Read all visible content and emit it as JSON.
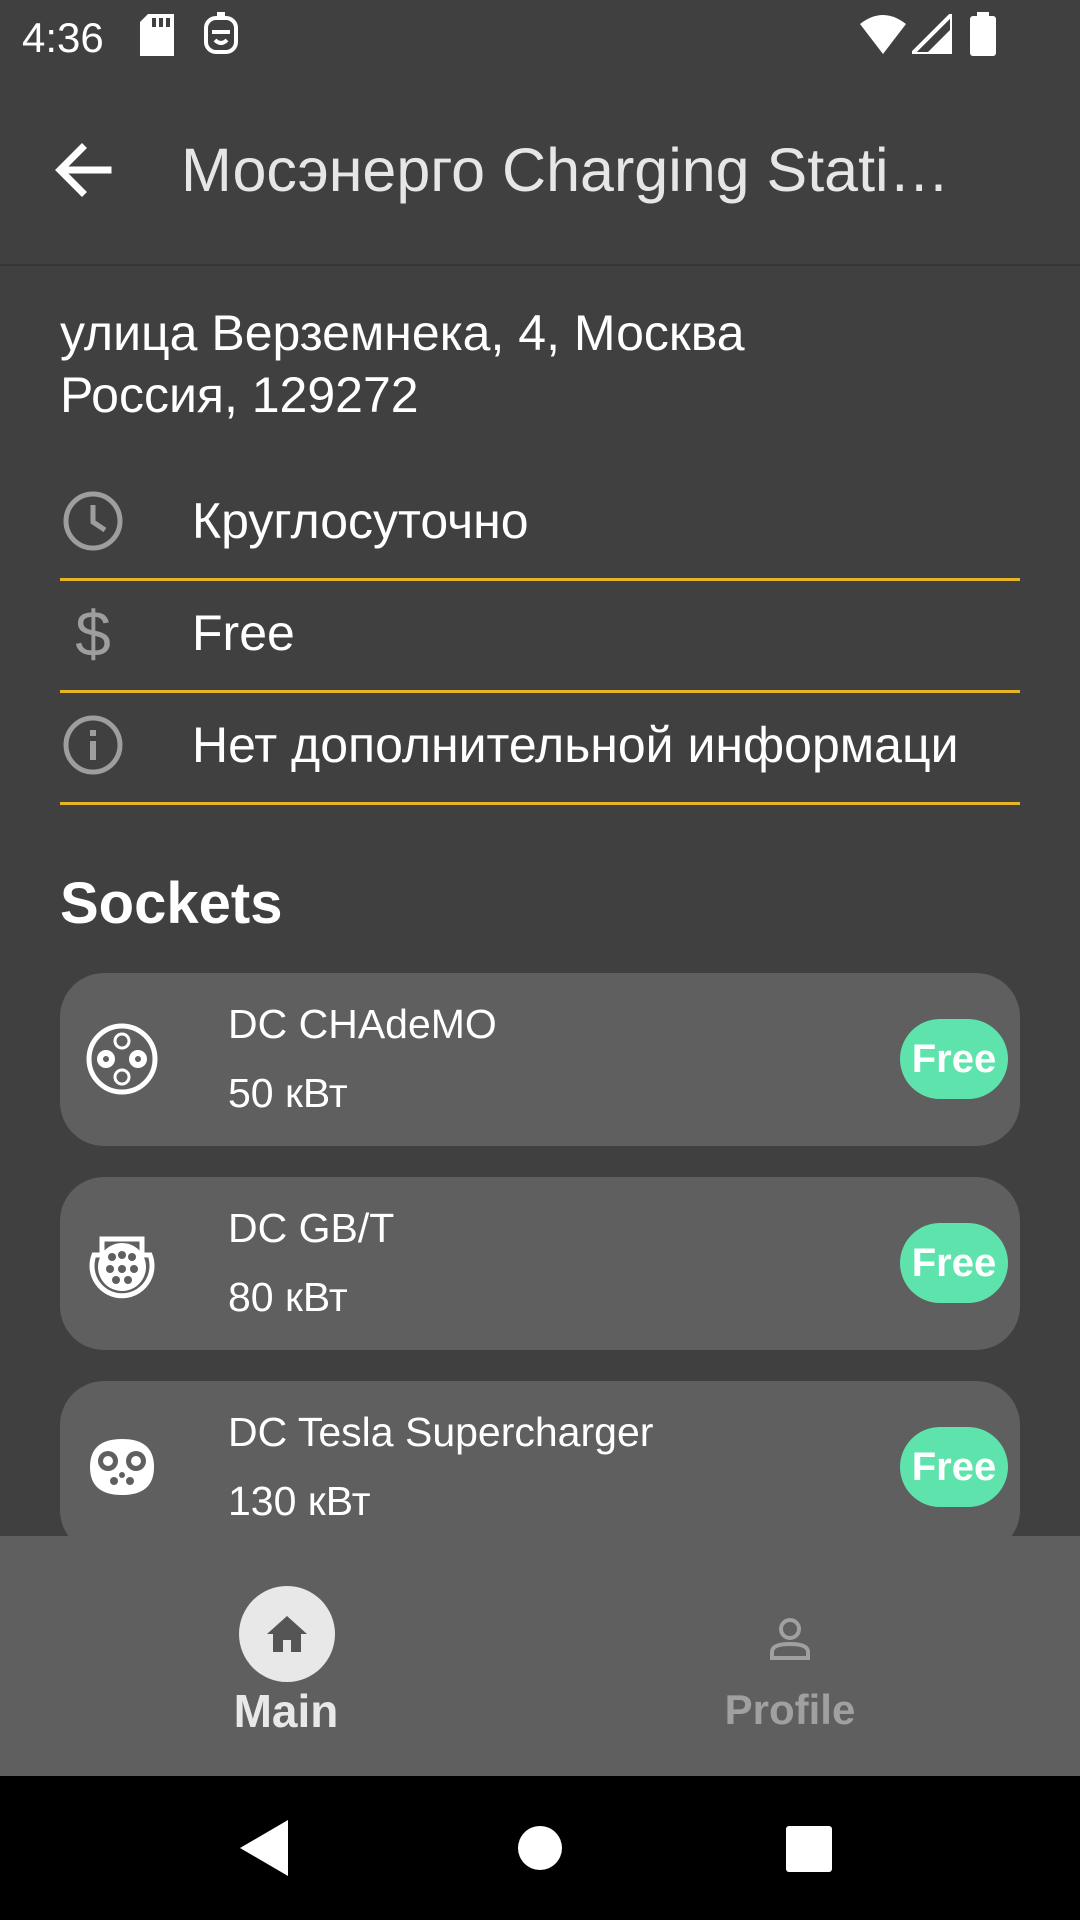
{
  "status_bar": {
    "time": "4:36"
  },
  "app_bar": {
    "title": "Мосэнерго Charging Stati…"
  },
  "address": {
    "line1": "улица Верземнека, 4, Москва",
    "line2": "Россия, 129272"
  },
  "info": [
    {
      "icon": "clock-icon",
      "text": "Круглосуточно"
    },
    {
      "icon": "dollar-icon",
      "text": "Free"
    },
    {
      "icon": "info-icon",
      "text": "Нет дополнительной информаци"
    }
  ],
  "sockets_heading": "Sockets",
  "sockets": [
    {
      "icon": "chademo-connector-icon",
      "name": "DC CHAdeMO",
      "power": "50 кВт",
      "status": "Free"
    },
    {
      "icon": "gbt-connector-icon",
      "name": "DC GB/T",
      "power": "80 кВт",
      "status": "Free"
    },
    {
      "icon": "tesla-connector-icon",
      "name": "DC Tesla Supercharger",
      "power": "130 кВт",
      "status": "Free"
    }
  ],
  "bottom_nav": {
    "main_label": "Main",
    "profile_label": "Profile",
    "selected": "Main"
  },
  "colors": {
    "background": "#404040",
    "card": "#5f5f5f",
    "accent_underline": "#e5b526",
    "status_free": "#5fe3ad"
  }
}
